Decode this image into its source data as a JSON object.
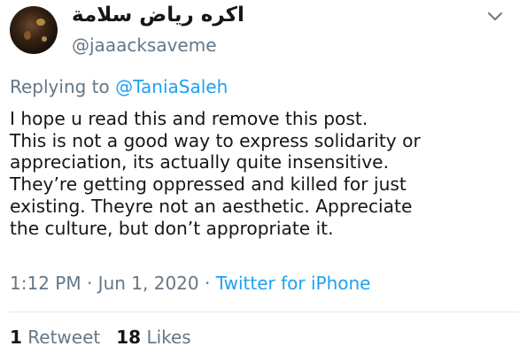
{
  "author": {
    "display_name": "اكره رياض سلامة",
    "handle": "@jaaacksaveme",
    "avatar_icon": "avatar-photo"
  },
  "menu": {
    "icon": "chevron-down-icon"
  },
  "reply": {
    "prefix": "Replying to ",
    "mention": "@TaniaSaleh"
  },
  "tweet": {
    "lines": [
      "I hope u read this and remove this post.",
      "This is not a good way to express solidarity or",
      "appreciation, its actually quite insensitive.",
      "They’re getting oppressed and killed for just",
      "existing. Theyre not an aesthetic. Appreciate",
      "the culture, but don’t appropriate it."
    ]
  },
  "meta": {
    "time": "1:12 PM",
    "separator": " · ",
    "date": "Jun 1, 2020",
    "separator2": " · ",
    "source": "Twitter for iPhone"
  },
  "stats": {
    "retweets_count": "1",
    "retweets_label": "Retweet",
    "likes_count": "18",
    "likes_label": "Likes"
  },
  "colors": {
    "link": "#1da1f2",
    "secondary_text": "#657786",
    "primary_text": "#14171a",
    "divider": "#e1e8ed"
  }
}
